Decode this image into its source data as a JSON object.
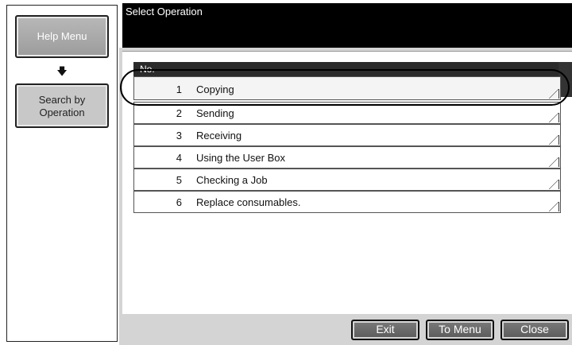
{
  "sidebar": {
    "help_menu": "Help Menu",
    "arrow": "🡇",
    "search_line1": "Search by",
    "search_line2": "Operation"
  },
  "header": {
    "title": "Select Operation"
  },
  "table": {
    "header_no": "No.",
    "rows": [
      {
        "num": "1",
        "label": "Copying"
      },
      {
        "num": "2",
        "label": "Sending"
      },
      {
        "num": "3",
        "label": "Receiving"
      },
      {
        "num": "4",
        "label": "Using the User Box"
      },
      {
        "num": "5",
        "label": "Checking a Job"
      },
      {
        "num": "6",
        "label": "Replace consumables."
      }
    ]
  },
  "footer": {
    "exit": "Exit",
    "to_menu": "To Menu",
    "close": "Close"
  },
  "colors": {
    "header_bg": "#000000",
    "frame_gray": "#d4d4d4",
    "button_gray": "#6a6a6a"
  },
  "icons": {
    "arrow": "down-arrow-icon",
    "row_corner": "corner-fold-icon"
  }
}
